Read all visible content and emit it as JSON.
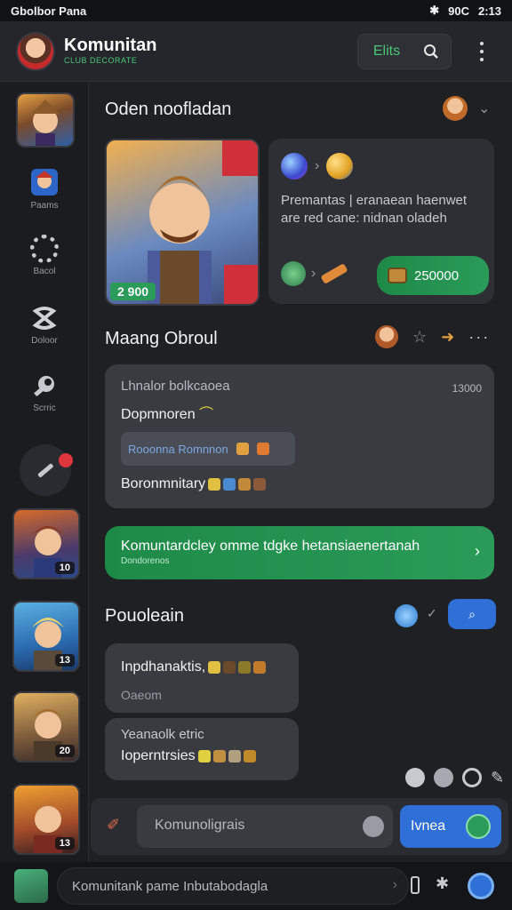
{
  "status_bar": {
    "left": "Gbolbor Pana",
    "signal": "90C",
    "time": "2:13"
  },
  "header": {
    "title": "Komunitan",
    "subtitle": "CLUB DECORATE",
    "pill_label": "Elits"
  },
  "sidebar": {
    "items": [
      {
        "label": "Paams",
        "icon": "shield-avatar-icon"
      },
      {
        "label": "Bacol",
        "icon": "gear-icon"
      },
      {
        "label": "Doloor",
        "icon": "knot-icon"
      },
      {
        "label": "Scrric",
        "icon": "wrench-icon"
      }
    ],
    "edit_badge": "",
    "games": [
      {
        "badge": "10"
      },
      {
        "badge": "13"
      },
      {
        "badge": "20"
      },
      {
        "badge": "13"
      }
    ]
  },
  "main": {
    "section1": {
      "title": "Oden noofladan"
    },
    "hero_card": {
      "score": "2 900"
    },
    "promo_card": {
      "text": "Premantas | eranaean haenwet are red cane: nidnan oladeh",
      "reward": "250000"
    },
    "section2": {
      "title": "Maang Obroul"
    },
    "message1": {
      "title": "Lhnalor bolkcaoea",
      "time": "13000",
      "line1": "Dopmnoren",
      "highlight": "Rooonna Romnnon",
      "line2": "Boronmnitary"
    },
    "green_banner": {
      "text": "Komuntardcley omme tdgke hetansiaenertanah",
      "sub": "Dondorenos"
    },
    "section3": {
      "title": "Pouoleain"
    },
    "message2": {
      "line1": "Inpdhanaktis,",
      "line2": "Oaeom"
    },
    "message3": {
      "line1": "Yeanaolk etric",
      "line2": "Ioperntrsies"
    }
  },
  "input_bar": {
    "placeholder": "Komunoligrais",
    "send_label": "Ivnea"
  },
  "bottom_bar": {
    "text": "Komunitank pame Inbutabodagla"
  },
  "colors": {
    "accent_green": "#2a9b58",
    "accent_blue": "#2f6fd8",
    "bg": "#1f2024",
    "card": "#2e2f35"
  }
}
